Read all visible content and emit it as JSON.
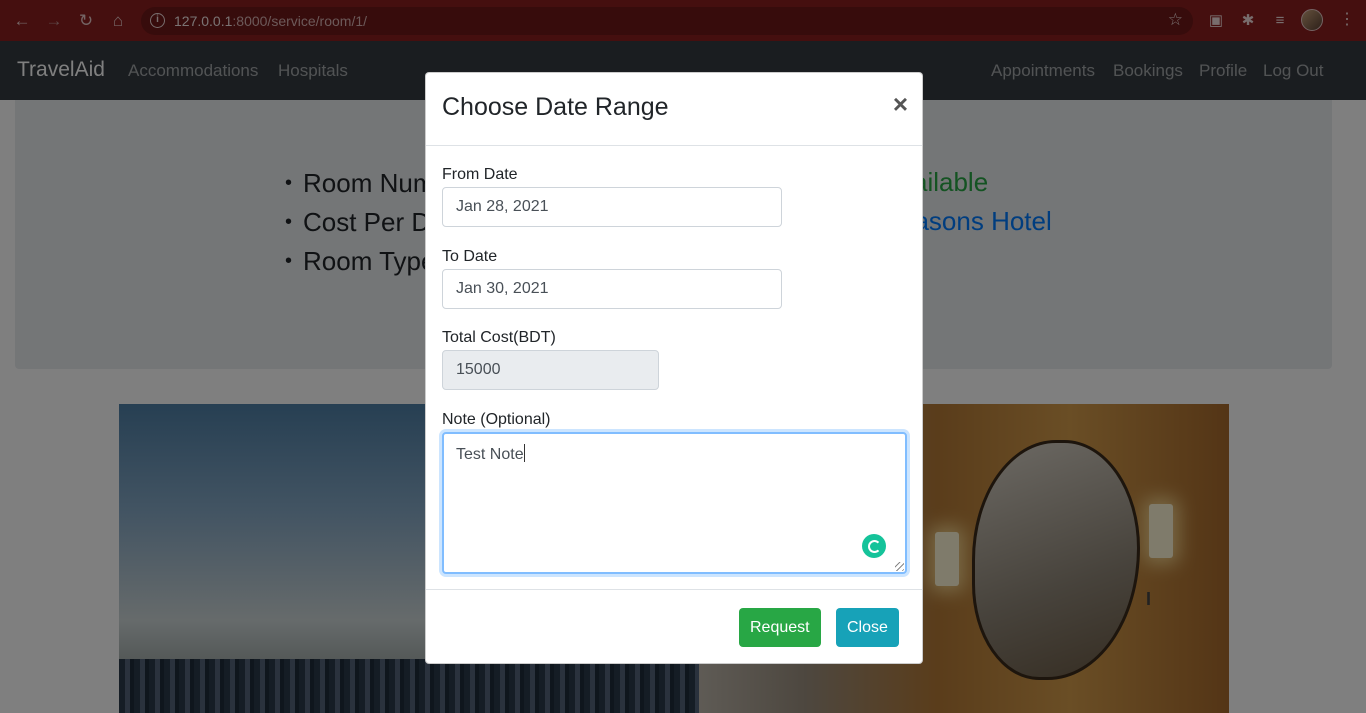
{
  "browser": {
    "url_host": "127.0.0.1",
    "url_path": ":8000/service/room/1/",
    "icons": {
      "back": "arrow-left-icon",
      "forward": "arrow-right-icon",
      "reload": "reload-icon",
      "home": "home-icon",
      "site_info": "info-icon",
      "bookmark": "star-icon",
      "menu": "kebab-menu-icon"
    }
  },
  "navbar": {
    "brand": "TravelAid",
    "left_links": [
      "Accommodations",
      "Hospitals"
    ],
    "right_links": [
      "Appointments",
      "Bookings",
      "Profile",
      "Log Out"
    ]
  },
  "room": {
    "items": [
      "Room Num",
      "Cost Per Da",
      "Room Type"
    ],
    "availability": "vailable",
    "hotel": "easons Hotel"
  },
  "modal": {
    "title": "Choose Date Range",
    "close_symbol": "×",
    "from_label": "From Date",
    "from_value": "Jan 28, 2021",
    "to_label": "To Date",
    "to_value": "Jan 30, 2021",
    "cost_label": "Total Cost(BDT)",
    "cost_value": "15000",
    "note_label": "Note (Optional)",
    "note_value": "Test Note",
    "request_label": "Request",
    "close_label": "Close"
  },
  "colors": {
    "navbar": "#343a40",
    "success": "#28a745",
    "info": "#17a2b8",
    "link": "#007bff",
    "chrome": "#8a1e1e"
  }
}
